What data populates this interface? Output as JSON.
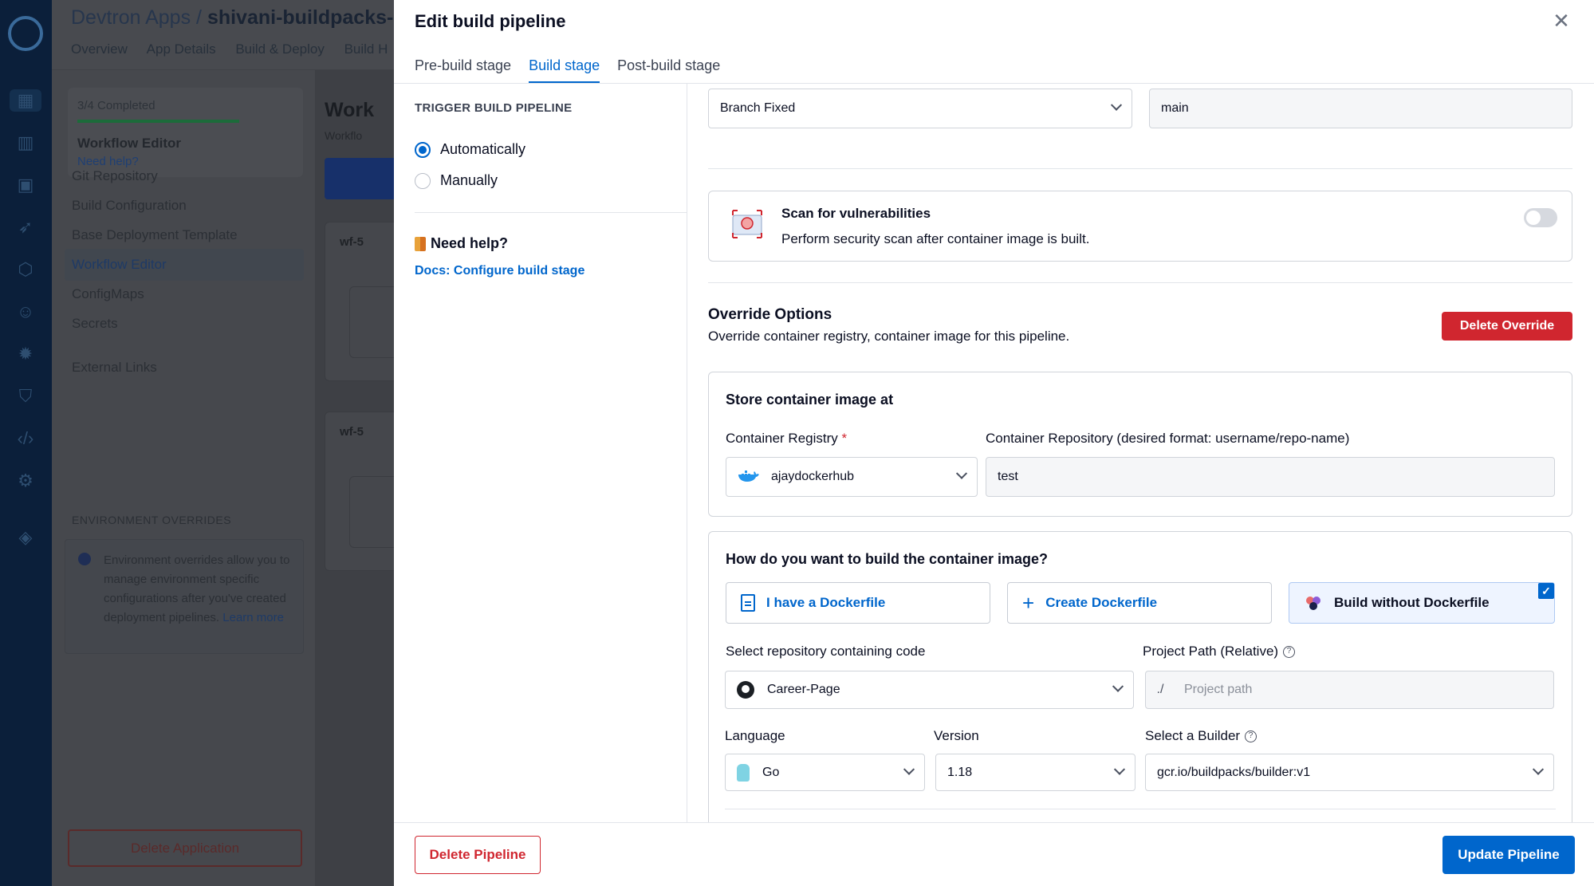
{
  "background": {
    "breadcrumb_prefix": "Devtron Apps /",
    "app_name": "shivani-buildpacks-app",
    "tabs": [
      "Overview",
      "App Details",
      "Build & Deploy",
      "Build H"
    ],
    "progress_label": "3/4 Completed",
    "progress_fraction": 0.75,
    "progress_title": "Workflow Editor",
    "progress_help": "Need help?",
    "nav": [
      "Git Repository",
      "Build Configuration",
      "Base Deployment Template",
      "Workflow Editor",
      "ConfigMaps",
      "Secrets",
      "External Links"
    ],
    "env_overrides_title": "ENVIRONMENT OVERRIDES",
    "env_info": "Environment overrides allow you to manage environment specific configurations after you've created deployment pipelines.",
    "env_info_link": "Learn more",
    "delete_application": "Delete Application",
    "workflow_title": "Work",
    "workflow_sub": "Workflo",
    "wf_card_1": "wf-5",
    "wf_card_2": "wf-5"
  },
  "modal": {
    "title": "Edit build pipeline",
    "tabs": [
      {
        "label": "Pre-build stage",
        "active": false
      },
      {
        "label": "Build stage",
        "active": true
      },
      {
        "label": "Post-build stage",
        "active": false
      }
    ]
  },
  "trigger": {
    "title": "TRIGGER BUILD PIPELINE",
    "automatic": "Automatically",
    "manual": "Manually",
    "selected": "Automatically"
  },
  "help": {
    "title": "Need help?",
    "docs_link": "Docs: Configure build stage"
  },
  "source": {
    "type": "Branch Fixed",
    "branch": "main"
  },
  "scan": {
    "title": "Scan for vulnerabilities",
    "description": "Perform security scan after container image is built.",
    "enabled": false
  },
  "override": {
    "title": "Override Options",
    "description": "Override container registry, container image for this pipeline.",
    "delete_button": "Delete Override"
  },
  "store": {
    "title": "Store container image at",
    "registry_label": "Container Registry",
    "registry_required": "*",
    "registry_value": "ajaydockerhub",
    "repo_label": "Container Repository (desired format: username/repo-name)",
    "repo_value": "test"
  },
  "build_method": {
    "title": "How do you want to build the container image?",
    "options": [
      "I have a Dockerfile",
      "Create Dockerfile",
      "Build without Dockerfile"
    ],
    "selected": "Build without Dockerfile",
    "check_mark": "✓"
  },
  "buildpack": {
    "repo_label": "Select repository containing code",
    "repo_value": "Career-Page",
    "path_label": "Project Path (Relative)",
    "path_prefix": "./",
    "path_placeholder": "Project path",
    "help_icon": "?",
    "language_label": "Language",
    "language_value": "Go",
    "version_label": "Version",
    "version_value": "1.18",
    "builder_label": "Select a Builder",
    "builder_value": "gcr.io/buildpacks/builder:v1"
  },
  "footer": {
    "delete_pipeline": "Delete Pipeline",
    "update_pipeline": "Update Pipeline"
  },
  "icons": {
    "close": "close-icon",
    "accent": "#0066cc",
    "danger": "#d0262f"
  }
}
